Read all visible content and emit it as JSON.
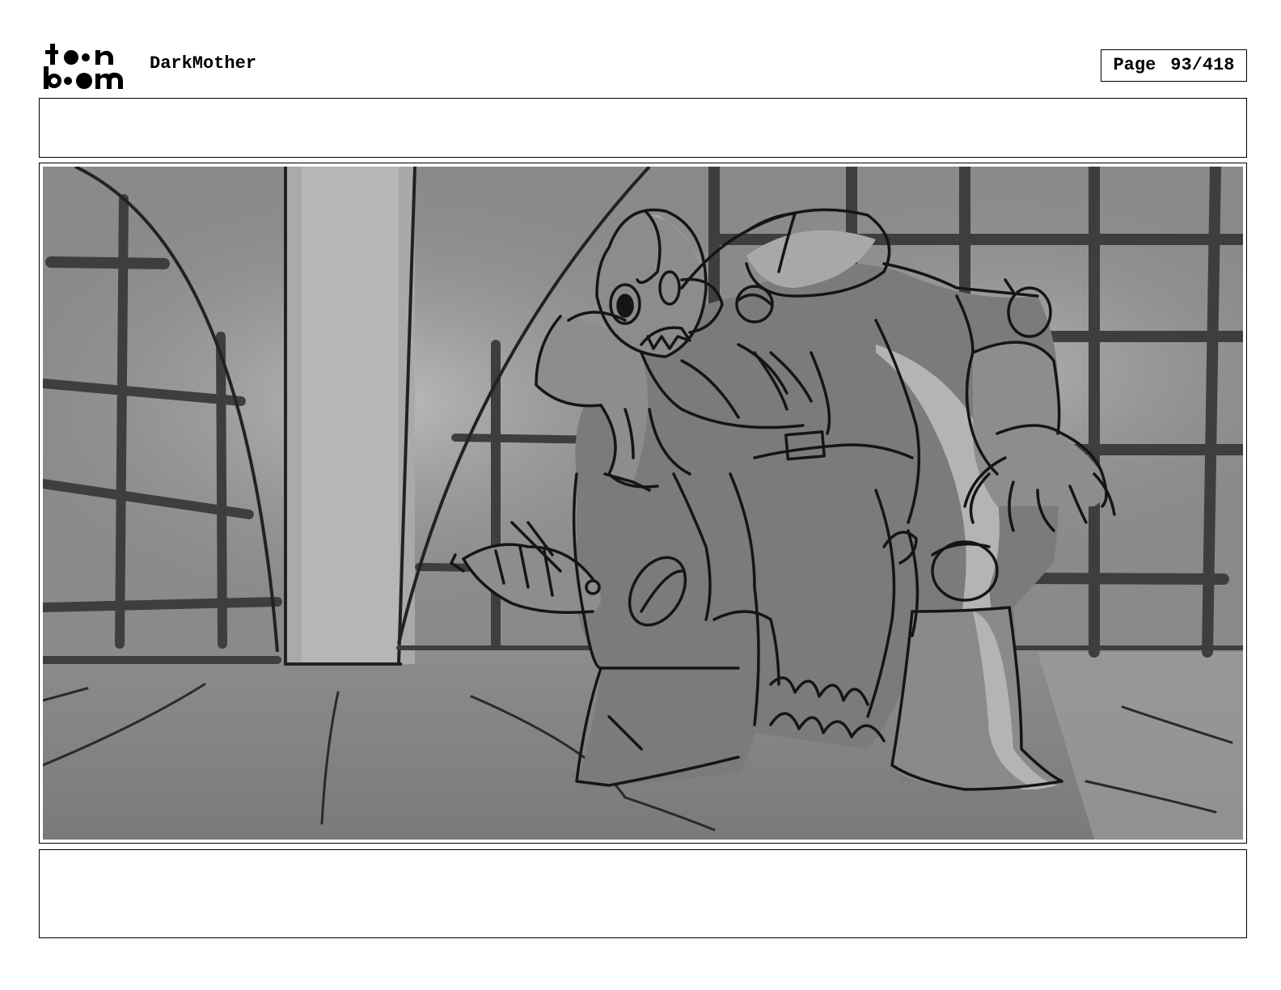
{
  "header": {
    "logo_text_line1": "toon",
    "logo_text_line2": "boom",
    "project_title": "DarkMother",
    "page_label": "Page",
    "page_number": "93/418"
  },
  "captions": {
    "top": "",
    "bottom": ""
  },
  "panel": {
    "background_color": "#8a8a8a",
    "light_color": "#b4b4b4",
    "line_color": "#151515",
    "grid_color": "#3e3e3e"
  }
}
